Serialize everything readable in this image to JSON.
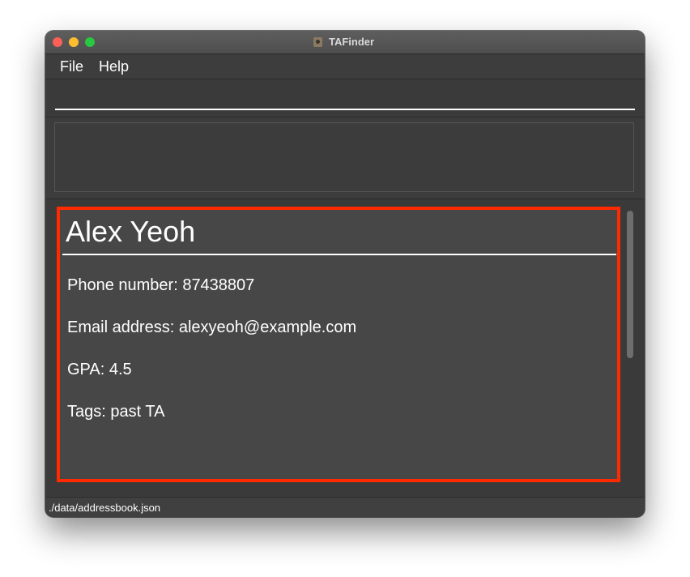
{
  "window": {
    "title": "TAFinder"
  },
  "titlebar": {
    "app_icon": "tafinder-app-icon"
  },
  "menu": {
    "file": "File",
    "help": "Help"
  },
  "command": {
    "value": "",
    "placeholder": ""
  },
  "result": {
    "text": ""
  },
  "person": {
    "name": "Alex Yeoh",
    "phone_label": "Phone number: 87438807",
    "email_label": "Email address: alexyeoh@example.com",
    "gpa_label": "GPA: 4.5",
    "tags_label": "Tags: past TA"
  },
  "status": {
    "path": "./data/addressbook.json"
  },
  "colors": {
    "window_bg": "#3c3c3c",
    "card_bg": "#474747",
    "highlight_border": "#ff2a00",
    "text": "#ffffff",
    "close": "#fe5f57",
    "minimize": "#febc2e",
    "maximize": "#28c840"
  }
}
